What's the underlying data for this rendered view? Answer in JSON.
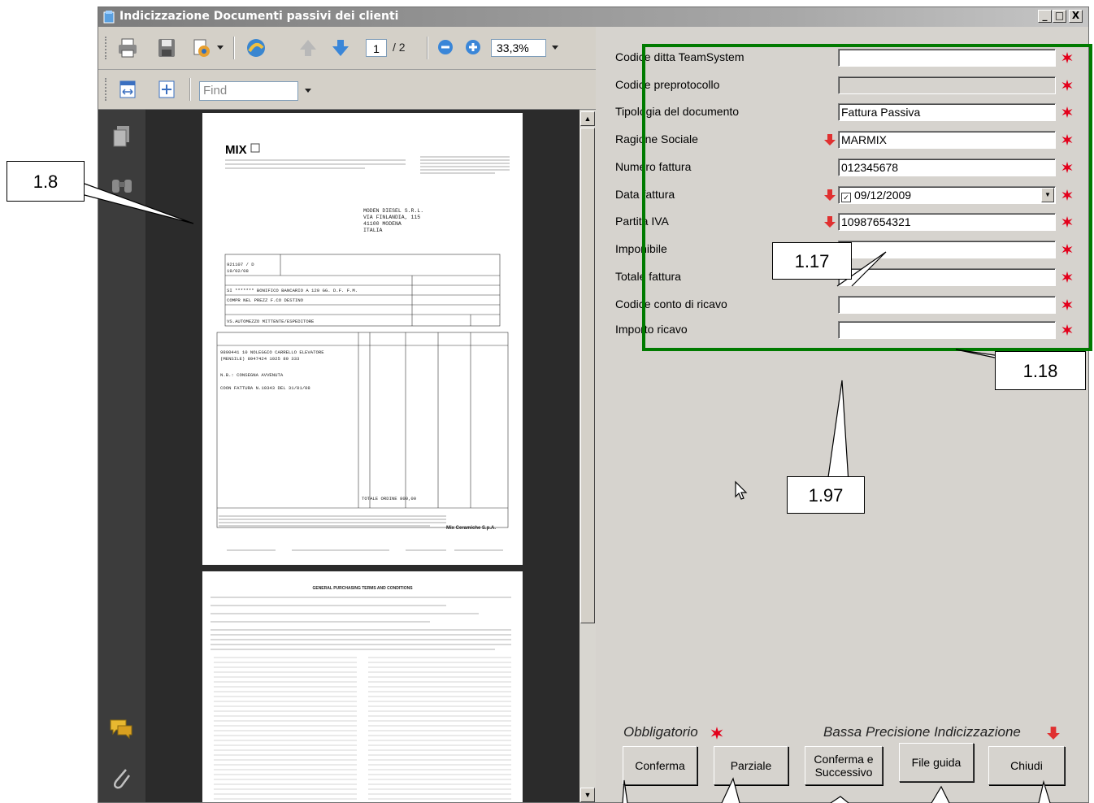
{
  "window": {
    "title": "Indicizzazione Documenti passivi dei clienti",
    "controls": [
      "_",
      "□",
      "X"
    ]
  },
  "viewer": {
    "page_current": "1",
    "page_total": "/ 2",
    "zoom": "33,3%",
    "find_placeholder": "Find"
  },
  "form": {
    "fields": [
      {
        "label": "Codice ditta TeamSystem",
        "value": ""
      },
      {
        "label": "Codice preprotocollo",
        "value": ""
      },
      {
        "label": "Tipologia del documento",
        "value": "Fattura Passiva"
      },
      {
        "label": "Ragione Sociale",
        "value": "MARMIX"
      },
      {
        "label": "Numero fattura",
        "value": "012345678"
      },
      {
        "label": "Data fattura",
        "value": "09/12/2009"
      },
      {
        "label": "Partita IVA",
        "value": "10987654321"
      },
      {
        "label": "Imponibile",
        "value": ""
      },
      {
        "label": "Totale fattura",
        "value": ""
      },
      {
        "label": "Codice conto di ricavo",
        "value": ""
      },
      {
        "label": "Importo ricavo",
        "value": ""
      }
    ],
    "legend_required": "Obbligatorio",
    "legend_low_precision": "Bassa Precisione Indicizzazione",
    "buttons": {
      "confirm": "Conferma",
      "partial": "Parziale",
      "confirm_next": "Conferma e Successivo",
      "guide": "File guida",
      "close": "Chiudi"
    }
  },
  "callouts": {
    "c1": "1.8",
    "c2": "1.17",
    "c3": "1.18",
    "c4": "1.97"
  },
  "document": {
    "logo": "MIX",
    "recipient": [
      "MODEN DIESEL S.R.L.",
      "VIA FINLANDIA, 115",
      "41100 MODENA",
      "ITALIA"
    ],
    "order_no": "921107 / D",
    "order_date": "19/02/08",
    "lines": [
      "SI ******* BONIFICO BANCARIO A 120 GG. D.F. F.M.",
      "COMPR NEL PREZZ F.CO DESTINO",
      "VS.AUTOMEZZO   MITTENTE/ESPEDITORE",
      "9800441  10   NOLEGGIO CARRELLO ELEVATORE",
      "(MENSILE)      8947424    1925 89 333",
      "N.B.: CONSEGNA AVVENUTA",
      "COON FATTURA N.10343 DEL 31/01/08"
    ],
    "total_line": "TOTALE ORDINE       800,00",
    "footer_company": "Mix Ceramiche S.p.A.",
    "page2_title": "GENERAL PURCHASING TERMS AND CONDITIONS"
  },
  "colors": {
    "annotation_green": "#007a00",
    "required_star": "#e3001b",
    "warning_arrow": "#e03030"
  }
}
